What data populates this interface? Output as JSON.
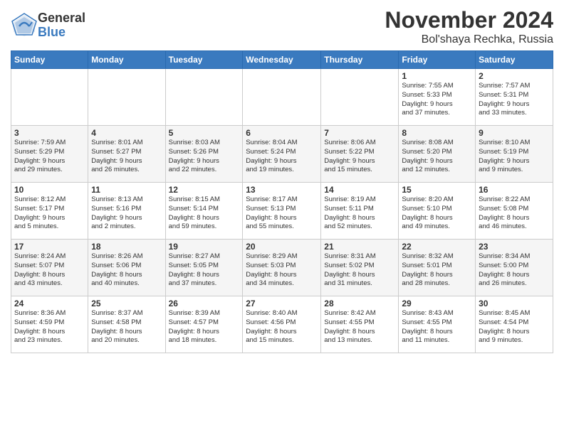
{
  "logo": {
    "general": "General",
    "blue": "Blue"
  },
  "title": "November 2024",
  "subtitle": "Bol'shaya Rechka, Russia",
  "headers": [
    "Sunday",
    "Monday",
    "Tuesday",
    "Wednesday",
    "Thursday",
    "Friday",
    "Saturday"
  ],
  "weeks": [
    [
      {
        "day": "",
        "info": ""
      },
      {
        "day": "",
        "info": ""
      },
      {
        "day": "",
        "info": ""
      },
      {
        "day": "",
        "info": ""
      },
      {
        "day": "",
        "info": ""
      },
      {
        "day": "1",
        "info": "Sunrise: 7:55 AM\nSunset: 5:33 PM\nDaylight: 9 hours\nand 37 minutes."
      },
      {
        "day": "2",
        "info": "Sunrise: 7:57 AM\nSunset: 5:31 PM\nDaylight: 9 hours\nand 33 minutes."
      }
    ],
    [
      {
        "day": "3",
        "info": "Sunrise: 7:59 AM\nSunset: 5:29 PM\nDaylight: 9 hours\nand 29 minutes."
      },
      {
        "day": "4",
        "info": "Sunrise: 8:01 AM\nSunset: 5:27 PM\nDaylight: 9 hours\nand 26 minutes."
      },
      {
        "day": "5",
        "info": "Sunrise: 8:03 AM\nSunset: 5:26 PM\nDaylight: 9 hours\nand 22 minutes."
      },
      {
        "day": "6",
        "info": "Sunrise: 8:04 AM\nSunset: 5:24 PM\nDaylight: 9 hours\nand 19 minutes."
      },
      {
        "day": "7",
        "info": "Sunrise: 8:06 AM\nSunset: 5:22 PM\nDaylight: 9 hours\nand 15 minutes."
      },
      {
        "day": "8",
        "info": "Sunrise: 8:08 AM\nSunset: 5:20 PM\nDaylight: 9 hours\nand 12 minutes."
      },
      {
        "day": "9",
        "info": "Sunrise: 8:10 AM\nSunset: 5:19 PM\nDaylight: 9 hours\nand 9 minutes."
      }
    ],
    [
      {
        "day": "10",
        "info": "Sunrise: 8:12 AM\nSunset: 5:17 PM\nDaylight: 9 hours\nand 5 minutes."
      },
      {
        "day": "11",
        "info": "Sunrise: 8:13 AM\nSunset: 5:16 PM\nDaylight: 9 hours\nand 2 minutes."
      },
      {
        "day": "12",
        "info": "Sunrise: 8:15 AM\nSunset: 5:14 PM\nDaylight: 8 hours\nand 59 minutes."
      },
      {
        "day": "13",
        "info": "Sunrise: 8:17 AM\nSunset: 5:13 PM\nDaylight: 8 hours\nand 55 minutes."
      },
      {
        "day": "14",
        "info": "Sunrise: 8:19 AM\nSunset: 5:11 PM\nDaylight: 8 hours\nand 52 minutes."
      },
      {
        "day": "15",
        "info": "Sunrise: 8:20 AM\nSunset: 5:10 PM\nDaylight: 8 hours\nand 49 minutes."
      },
      {
        "day": "16",
        "info": "Sunrise: 8:22 AM\nSunset: 5:08 PM\nDaylight: 8 hours\nand 46 minutes."
      }
    ],
    [
      {
        "day": "17",
        "info": "Sunrise: 8:24 AM\nSunset: 5:07 PM\nDaylight: 8 hours\nand 43 minutes."
      },
      {
        "day": "18",
        "info": "Sunrise: 8:26 AM\nSunset: 5:06 PM\nDaylight: 8 hours\nand 40 minutes."
      },
      {
        "day": "19",
        "info": "Sunrise: 8:27 AM\nSunset: 5:05 PM\nDaylight: 8 hours\nand 37 minutes."
      },
      {
        "day": "20",
        "info": "Sunrise: 8:29 AM\nSunset: 5:03 PM\nDaylight: 8 hours\nand 34 minutes."
      },
      {
        "day": "21",
        "info": "Sunrise: 8:31 AM\nSunset: 5:02 PM\nDaylight: 8 hours\nand 31 minutes."
      },
      {
        "day": "22",
        "info": "Sunrise: 8:32 AM\nSunset: 5:01 PM\nDaylight: 8 hours\nand 28 minutes."
      },
      {
        "day": "23",
        "info": "Sunrise: 8:34 AM\nSunset: 5:00 PM\nDaylight: 8 hours\nand 26 minutes."
      }
    ],
    [
      {
        "day": "24",
        "info": "Sunrise: 8:36 AM\nSunset: 4:59 PM\nDaylight: 8 hours\nand 23 minutes."
      },
      {
        "day": "25",
        "info": "Sunrise: 8:37 AM\nSunset: 4:58 PM\nDaylight: 8 hours\nand 20 minutes."
      },
      {
        "day": "26",
        "info": "Sunrise: 8:39 AM\nSunset: 4:57 PM\nDaylight: 8 hours\nand 18 minutes."
      },
      {
        "day": "27",
        "info": "Sunrise: 8:40 AM\nSunset: 4:56 PM\nDaylight: 8 hours\nand 15 minutes."
      },
      {
        "day": "28",
        "info": "Sunrise: 8:42 AM\nSunset: 4:55 PM\nDaylight: 8 hours\nand 13 minutes."
      },
      {
        "day": "29",
        "info": "Sunrise: 8:43 AM\nSunset: 4:55 PM\nDaylight: 8 hours\nand 11 minutes."
      },
      {
        "day": "30",
        "info": "Sunrise: 8:45 AM\nSunset: 4:54 PM\nDaylight: 8 hours\nand 9 minutes."
      }
    ]
  ]
}
